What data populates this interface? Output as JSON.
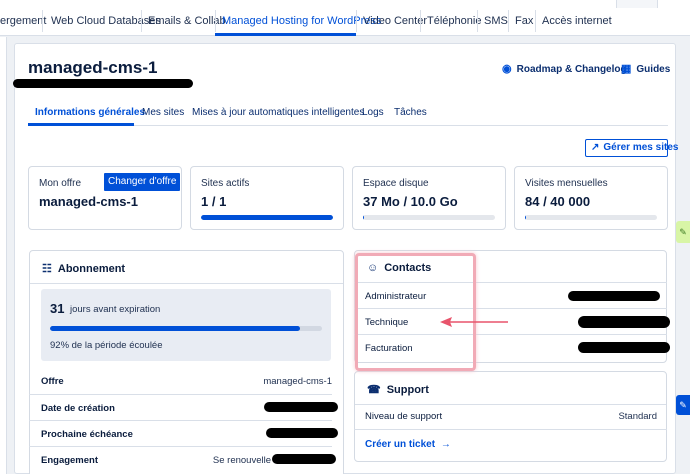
{
  "top_nav": {
    "tabs": [
      {
        "label": "ergement"
      },
      {
        "label": "Web Cloud Databases"
      },
      {
        "label": "Emails & Collab"
      },
      {
        "label": "Managed Hosting for WordPress"
      },
      {
        "label": "Video Center"
      },
      {
        "label": "Téléphonie"
      },
      {
        "label": "SMS"
      },
      {
        "label": "Fax"
      },
      {
        "label": "Accès internet"
      }
    ],
    "active_index": 3
  },
  "header": {
    "title": "managed-cms-1",
    "roadmap_label": "Roadmap & Changelog",
    "guides_label": "Guides"
  },
  "subtabs": [
    {
      "label": "Informations générales"
    },
    {
      "label": "Mes sites"
    },
    {
      "label": "Mises à jour automatiques intelligentes"
    },
    {
      "label": "Logs"
    },
    {
      "label": "Tâches"
    }
  ],
  "manage_sites_label": "Gérer mes sites",
  "cards": {
    "offer": {
      "label": "Mon offre",
      "value": "managed-cms-1",
      "button_label": "Changer d'offre"
    },
    "sites": {
      "label": "Sites actifs",
      "value": "1 / 1",
      "progress": 1.0
    },
    "disk": {
      "label": "Espace disque",
      "value": "37 Mo / 10.0 Go",
      "progress": 0.0037
    },
    "visits": {
      "label": "Visites mensuelles",
      "value": "84 / 40 000",
      "progress": 0.0021
    }
  },
  "subscription": {
    "title": "Abonnement",
    "days_left": "31",
    "days_text": "jours avant expiration",
    "progress": 0.92,
    "elapsed_text": "92% de la période écoulée",
    "rows": [
      {
        "key": "Offre",
        "value": "managed-cms-1"
      },
      {
        "key": "Date de création",
        "value": ""
      },
      {
        "key": "Prochaine échéance",
        "value": ""
      },
      {
        "key": "Engagement",
        "value": "Se renouvelle"
      }
    ]
  },
  "contacts": {
    "title": "Contacts",
    "rows": [
      {
        "key": "Administrateur"
      },
      {
        "key": "Technique"
      },
      {
        "key": "Facturation"
      }
    ]
  },
  "support": {
    "title": "Support",
    "level_label": "Niveau de support",
    "level_value": "Standard",
    "ticket_label": "Créer un ticket"
  },
  "colors": {
    "accent": "#0050d7",
    "annotation": "#e8546b"
  }
}
